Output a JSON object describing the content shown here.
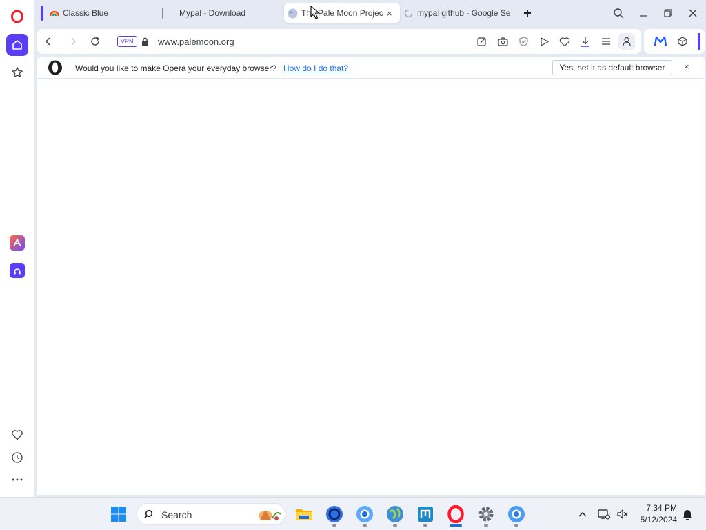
{
  "colors": {
    "accent": "#5b3df5",
    "opera_red": "#ff1b2d",
    "link": "#1a73e8",
    "page_bg": "#e4e9f3"
  },
  "sidebar": {
    "items": [
      {
        "icon": "opera-logo-icon"
      },
      {
        "icon": "home-icon",
        "active": true
      },
      {
        "icon": "star-icon"
      },
      {
        "icon": "aria-icon"
      },
      {
        "icon": "music-player-icon"
      },
      {
        "icon": "heart-icon"
      },
      {
        "icon": "history-icon"
      },
      {
        "icon": "more-icon"
      }
    ]
  },
  "tabs": [
    {
      "label": "Classic Blue",
      "icon": "rainbow-icon"
    },
    {
      "label": "Mypal - Download",
      "icon": ""
    },
    {
      "label": "The Pale Moon Project",
      "icon": "pale-moon-icon",
      "active": true,
      "close": "×"
    },
    {
      "label": "mypal github - Google Se",
      "icon": "loading-spinner-icon"
    }
  ],
  "toolbar": {
    "vpn_label": "VPN",
    "url": "www.palemoon.org"
  },
  "notification": {
    "text": "Would you like to make Opera your everyday browser?",
    "link": "How do I do that?",
    "button": "Yes, set it as default browser",
    "close": "×"
  },
  "taskbar": {
    "search_label": "Search",
    "time": "7:34 PM",
    "date": "5/12/2024"
  }
}
